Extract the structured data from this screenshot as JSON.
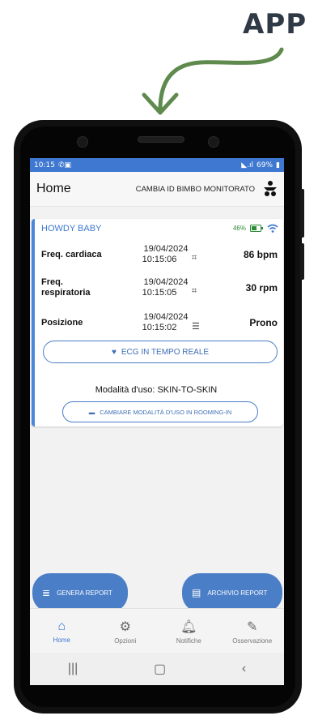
{
  "caption": "APP",
  "status_bar": {
    "time": "10:15",
    "battery": "69%",
    "signal": "◣.ıl"
  },
  "app_bar": {
    "title": "Home",
    "change_label": "CAMBIA ID BIMBO MONITORATO"
  },
  "card": {
    "device_name": "HOWDY BABY",
    "battery_percent": "46%",
    "rows": [
      {
        "label": "Freq. cardiaca",
        "date": "19/04/2024",
        "time": "10:15:06",
        "value": "86 bpm",
        "icon": "chart-icon"
      },
      {
        "label": "Freq.\nrespiratoria",
        "date": "19/04/2024",
        "time": "10:15:05",
        "value": "30 rpm",
        "icon": "chart-icon"
      },
      {
        "label": "Posizione",
        "date": "19/04/2024",
        "time": "10:15:02",
        "value": "Prono",
        "icon": "list-icon"
      }
    ],
    "ecg_button": "ECG IN TEMPO REALE",
    "mode_label": "Modalità d'uso:",
    "mode_value": "SKIN-TO-SKIN",
    "change_mode_button": "CAMBIARE MODALITÀ D'USO IN ROOMING-IN"
  },
  "actions": {
    "generate": "GENERA REPORT",
    "archive": "ARCHIVIO REPORT"
  },
  "bottom_nav": [
    {
      "label": "Home",
      "icon": "home-icon",
      "active": true
    },
    {
      "label": "Opzioni",
      "icon": "gear-icon",
      "active": false
    },
    {
      "label": "Notifiche",
      "icon": "bell-icon",
      "active": false
    },
    {
      "label": "Osservazione",
      "icon": "pencil-icon",
      "active": false
    }
  ],
  "colors": {
    "accent": "#3f78d1",
    "green": "#2e8b3a",
    "arrow": "#5f8a4e"
  }
}
